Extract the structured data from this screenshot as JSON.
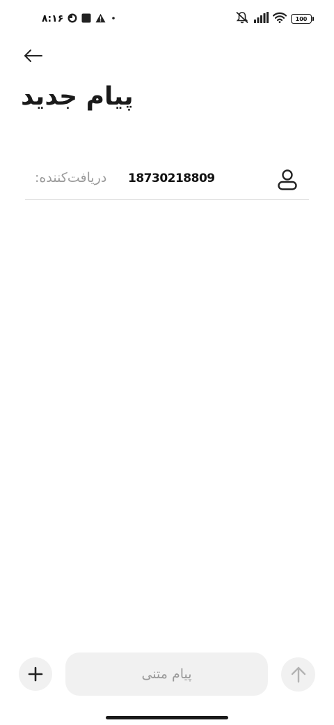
{
  "status_bar": {
    "time": "۸:۱۶",
    "battery_level": "100",
    "icons_left": [
      "circle-app-icon",
      "square-app-icon",
      "warning-icon",
      "dot-icon"
    ],
    "icons_right": [
      "mute-icon",
      "signal-icon",
      "wifi-icon",
      "battery-icon"
    ]
  },
  "header": {
    "back_icon": "arrow-left-icon",
    "title": "پیام جدید"
  },
  "recipient": {
    "label": "دریافت‌کننده:",
    "number": "18730218809",
    "icon": "person-icon"
  },
  "composer": {
    "add_icon": "plus-icon",
    "placeholder": "پیام متنی",
    "value": "",
    "send_icon": "arrow-up-icon"
  },
  "colors": {
    "background": "#ffffff",
    "composer_bg": "#f1f1f1",
    "placeholder": "#9a9a9a",
    "text": "#1a1a1a",
    "divider": "#dcdcdc",
    "send_arrow_disabled": "#b3b3b3"
  }
}
